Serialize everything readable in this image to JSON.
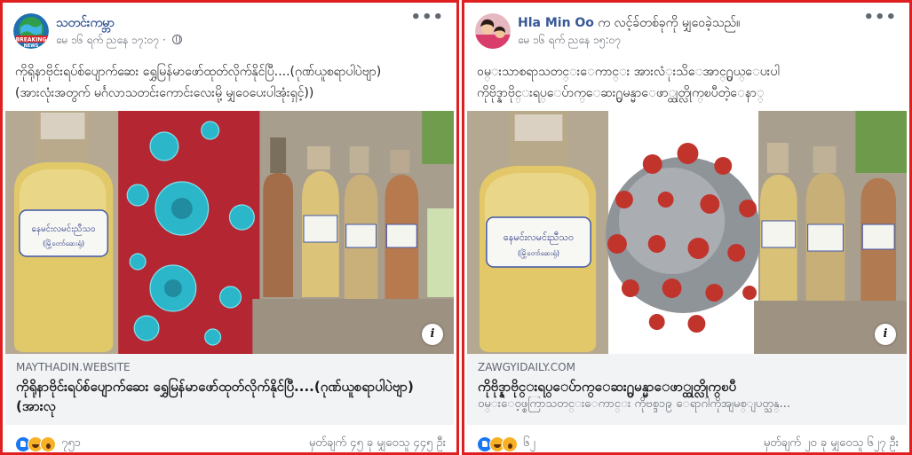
{
  "left_post": {
    "page_name": "သတင်းကမ္ဘာ",
    "timestamp": "မေ ၁၆ ရက် ညနေ ၁၇:၀၇ · ",
    "caption_line1": "ကိုရိုနာဗိုင်းရပ်စ်ပျောက်ဆေး ရွှေမြန်မာဖော်ထုတ်လိုက်နိုင်ပြီ....(ဂုဏ်ယူစရာပါပဲဗျာ)",
    "caption_line2": "(အားလုံးအတွက် မင်္ဂလာသတင်းကောင်းလေးမို့ မျှဝေပေးပါအုံးရှင့်))",
    "bottle_label": "နေမင်းလမင်းညီသဝ",
    "bottle_sublabel": "(မြို့တော်ဆေးရုံ)",
    "link_domain": "MAYTHADIN.WEBSITE",
    "link_title": "ကိုရိုနာဗိုင်းရပ်စ်ပျောက်ဆေး ရွှေမြန်မာဖော်ထုတ်လိုက်နိုင်ပြီ....(ဂုဏ်ယူစရာပါပဲဗျာ) (အားလု",
    "reaction_count": "၇၅၁",
    "stats": "မှတ်ချက် ၄၅ ခု  မျှဝေသူ ၄၄၅ ဦး"
  },
  "right_post": {
    "page_name": "Hla Min Oo",
    "shared_text": " က လင့်ခ်တစ်ခုကို မျှဝေခဲ့သည်။",
    "timestamp": "မေ ၁၆ ရက် ညနေ ၁၅:၀၇",
    "caption_line1": "ဝမ္းသာစရာသတင္းေကာင္း အားလံုးသိေအာင္႐ွယ္ေပးပါ",
    "caption_line2": "ကိုဗိုဒ္နာဗိုင္းရပ္ေပ်ာက္ေဆး႐ွမန္မာေဖာ္ထုတ္လိုက္ၿပီတဲ့ေနာ္",
    "bottle_label": "နေမင်းလမင်းညီသဝ",
    "bottle_sublabel": "(မြို့တော်ဆေးရုံ)",
    "link_domain": "ZAWGYIDAILY.COM",
    "link_title": "ကိုဗိုဒ္နာဗိုင္းရပ္ေပ်ာက္ေဆး႐ွမန္မာေဖာ္ထုတ္လိုက္ၿပီ",
    "link_desc": "ဝမ္းေဝ့ဖ္စကြာသတင္းေကာင္း ကိုဗစ္ဒ၁၉ ေရာဂါကိုအျမစ္ျပတ္သန္...",
    "reaction_count": "၆၂",
    "stats": "မှတ်ချက် ၂၀ ခု  မျှဝေသူ ၆၂၇ ဦး"
  },
  "icons": {
    "more": "more-options-icon",
    "globe": "globe-icon",
    "info": "info-icon"
  },
  "colors": {
    "highlight_border": "#e02020",
    "name_link": "#385898",
    "link_box_bg": "#f2f3f5",
    "virus_cyan": "#2bb7c9",
    "virus_red": "#c0342c",
    "like_blue": "#1877f2"
  }
}
